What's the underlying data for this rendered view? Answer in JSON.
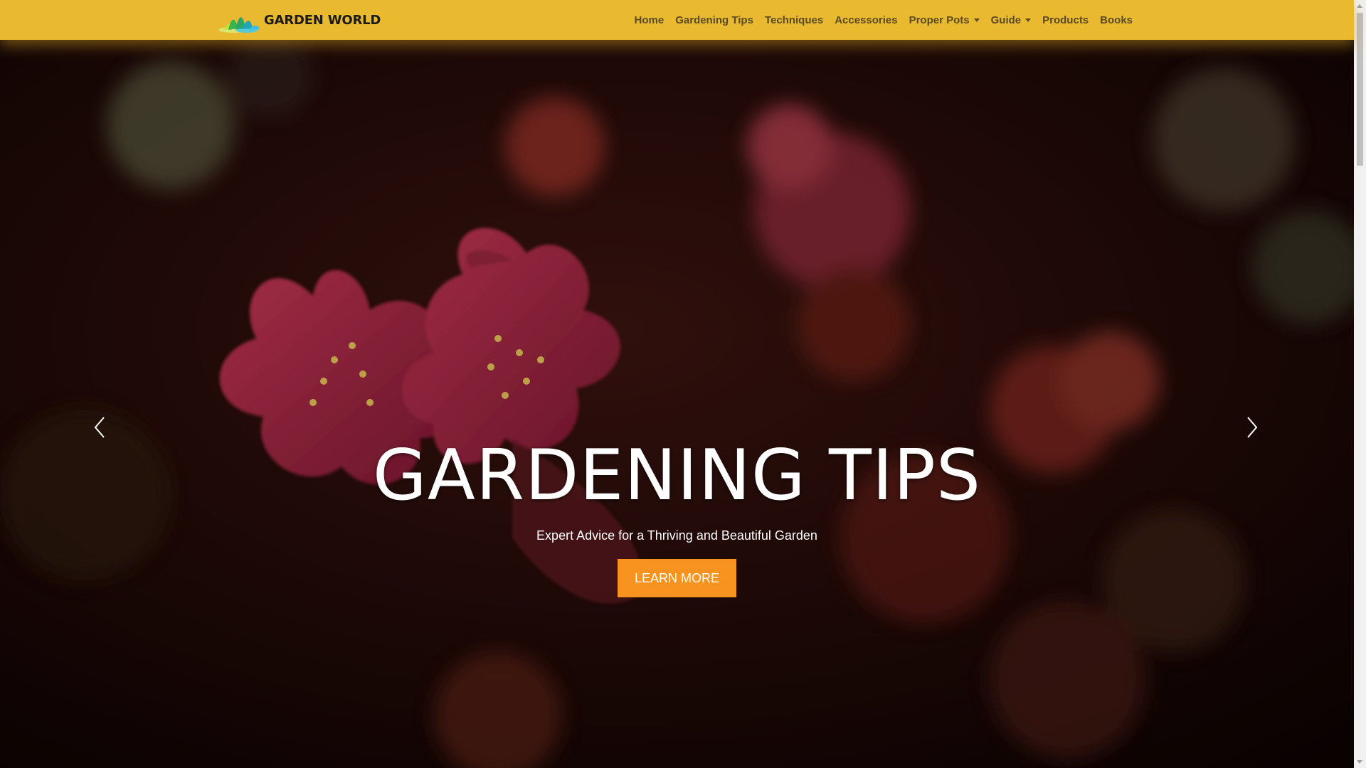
{
  "brand": {
    "name": "GARDEN WORLD",
    "logo_icon": "lotus-logo-icon"
  },
  "nav": {
    "items": [
      {
        "label": "Home",
        "dropdown": false
      },
      {
        "label": "Gardening Tips",
        "dropdown": false
      },
      {
        "label": "Techniques",
        "dropdown": false
      },
      {
        "label": "Accessories",
        "dropdown": false
      },
      {
        "label": "Proper Pots",
        "dropdown": true
      },
      {
        "label": "Guide",
        "dropdown": true
      },
      {
        "label": "Products",
        "dropdown": false
      },
      {
        "label": "Books",
        "dropdown": false
      }
    ]
  },
  "hero": {
    "title": "GARDENING TIPS",
    "subtitle": "Expert Advice for a Thriving and Beautiful Garden",
    "cta_label": "LEARN MORE",
    "prev_icon": "chevron-left-icon",
    "next_icon": "chevron-right-icon"
  },
  "colors": {
    "navbar": "#e9b92f",
    "nav_text": "#5a4a26",
    "cta": "#f7931e",
    "hero_text": "#ffffff"
  }
}
